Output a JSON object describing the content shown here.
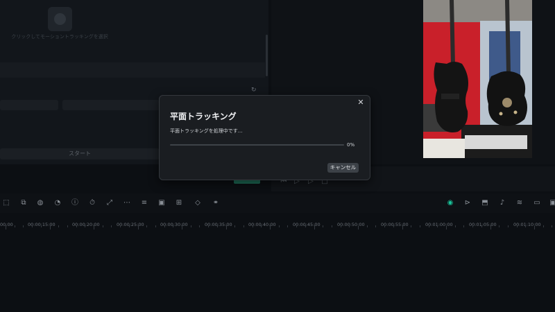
{
  "left_panel": {
    "hint": "クリックしてモーショントラッキングを選択",
    "start_label": "スタート"
  },
  "timeline": {
    "timestamps": [
      "00:00",
      "00:00:15:00",
      "00:00:20:00",
      "00:00:25:00",
      "00:00:30:00",
      "00:00:35:00",
      "00:00:40:00",
      "00:00:45:00",
      "00:00:50:00",
      "00:00:55:00",
      "00:01:00:00",
      "00:01:05:00",
      "00:01:10:00"
    ]
  },
  "dialog": {
    "title": "平面トラッキング",
    "message": "平面トラッキングを処理中です...",
    "progress": 0,
    "progress_label": "0%",
    "cancel_label": "キャンセル"
  },
  "colors": {
    "accent": "#19c39a",
    "background": "#0c0f13",
    "dialog": "#1a1d21"
  }
}
